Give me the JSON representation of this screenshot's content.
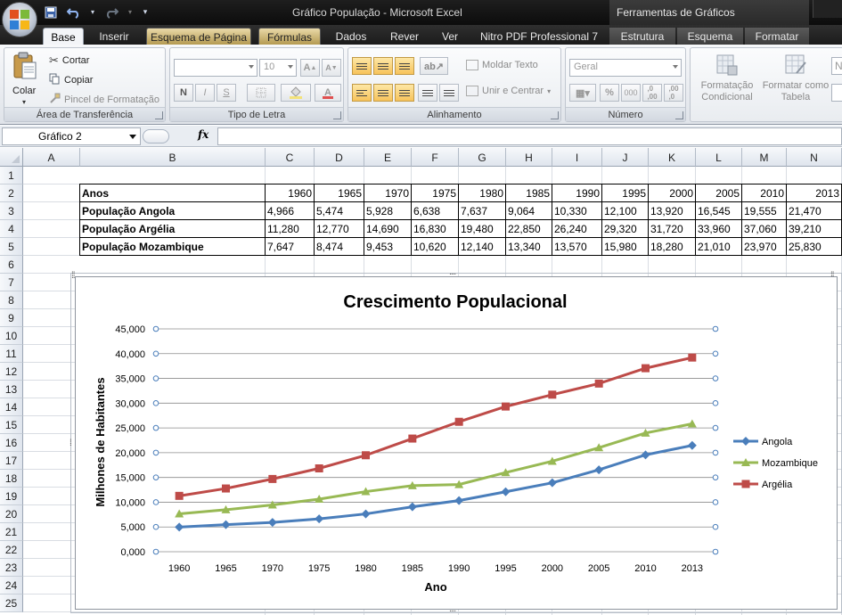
{
  "window": {
    "title": "Gráfico População - Microsoft Excel",
    "context_title": "Ferramentas de Gráficos"
  },
  "tabs": [
    {
      "label": "Base",
      "active": true
    },
    {
      "label": "Inserir"
    },
    {
      "label": "Esquema de Página"
    },
    {
      "label": "Fórmulas"
    },
    {
      "label": "Dados"
    },
    {
      "label": "Rever"
    },
    {
      "label": "Ver"
    },
    {
      "label": "Nitro PDF Professional 7"
    },
    {
      "label": "Estrutura"
    },
    {
      "label": "Esquema"
    },
    {
      "label": "Formatar"
    }
  ],
  "ribbon": {
    "clipboard": {
      "paste": "Colar",
      "cut": "Cortar",
      "copy": "Copiar",
      "format_painter": "Pincel de Formatação",
      "label": "Área de Transferência"
    },
    "font": {
      "font_size": "10",
      "label": "Tipo de Letra",
      "bold": "N",
      "italic": "I",
      "underline": "S"
    },
    "alignment": {
      "wrap_text": "Moldar Texto",
      "merge_center": "Unir e Centrar",
      "label": "Alinhamento"
    },
    "number": {
      "format": "Geral",
      "percent": "%",
      "thousands": "000",
      "label": "Número"
    },
    "styles": {
      "conditional": "Formatação Condicional",
      "table": "Formatar como Tabela",
      "clipped": "N"
    }
  },
  "formula_bar": {
    "name_box": "Gráfico 2",
    "fx": "fx"
  },
  "columns": [
    "A",
    "B",
    "C",
    "D",
    "E",
    "F",
    "G",
    "H",
    "I",
    "J",
    "K",
    "L",
    "M",
    "N"
  ],
  "rows": [
    "1",
    "2",
    "3",
    "4",
    "5",
    "6",
    "7",
    "8",
    "9",
    "10",
    "11",
    "12",
    "13",
    "14",
    "15",
    "16",
    "17",
    "18",
    "19",
    "20",
    "21",
    "22",
    "23",
    "24",
    "25"
  ],
  "table": {
    "header_label": "Anos",
    "years": [
      "1960",
      "1965",
      "1970",
      "1975",
      "1980",
      "1985",
      "1990",
      "1995",
      "2000",
      "2005",
      "2010",
      "2013"
    ],
    "rows": [
      {
        "label": "População Angola",
        "values": [
          "4,966",
          "5,474",
          "5,928",
          "6,638",
          "7,637",
          "9,064",
          "10,330",
          "12,100",
          "13,920",
          "16,545",
          "19,555",
          "21,470"
        ]
      },
      {
        "label": "População Argélia",
        "values": [
          "11,280",
          "12,770",
          "14,690",
          "16,830",
          "19,480",
          "22,850",
          "26,240",
          "29,320",
          "31,720",
          "33,960",
          "37,060",
          "39,210"
        ]
      },
      {
        "label": "População Mozambique",
        "values": [
          "7,647",
          "8,474",
          "9,453",
          "10,620",
          "12,140",
          "13,340",
          "13,570",
          "15,980",
          "18,280",
          "21,010",
          "23,970",
          "25,830"
        ]
      }
    ]
  },
  "chart_data": {
    "type": "line",
    "title": "Crescimento Populacional",
    "xlabel": "Ano",
    "ylabel": "Milhones de Habitantes",
    "categories": [
      "1960",
      "1965",
      "1970",
      "1975",
      "1980",
      "1985",
      "1990",
      "1995",
      "2000",
      "2005",
      "2010",
      "2013"
    ],
    "ylim": [
      0,
      45000
    ],
    "yticks": [
      0,
      5000,
      10000,
      15000,
      20000,
      25000,
      30000,
      35000,
      40000,
      45000
    ],
    "ytick_labels": [
      "0,000",
      "5,000",
      "10,000",
      "15,000",
      "20,000",
      "25,000",
      "30,000",
      "35,000",
      "40,000",
      "45,000"
    ],
    "grid": true,
    "legend": "right",
    "series": [
      {
        "name": "Angola",
        "color": "#4a7ebb",
        "marker": "diamond",
        "values": [
          4966,
          5474,
          5928,
          6638,
          7637,
          9064,
          10330,
          12100,
          13920,
          16545,
          19555,
          21470
        ]
      },
      {
        "name": "Mozambique",
        "color": "#98b954",
        "marker": "triangle",
        "values": [
          7647,
          8474,
          9453,
          10620,
          12140,
          13340,
          13570,
          15980,
          18280,
          21010,
          23970,
          25830
        ]
      },
      {
        "name": "Argélia",
        "color": "#be4b48",
        "marker": "square",
        "values": [
          11280,
          12770,
          14690,
          16830,
          19480,
          22850,
          26240,
          29320,
          31720,
          33960,
          37060,
          39210
        ]
      }
    ]
  }
}
